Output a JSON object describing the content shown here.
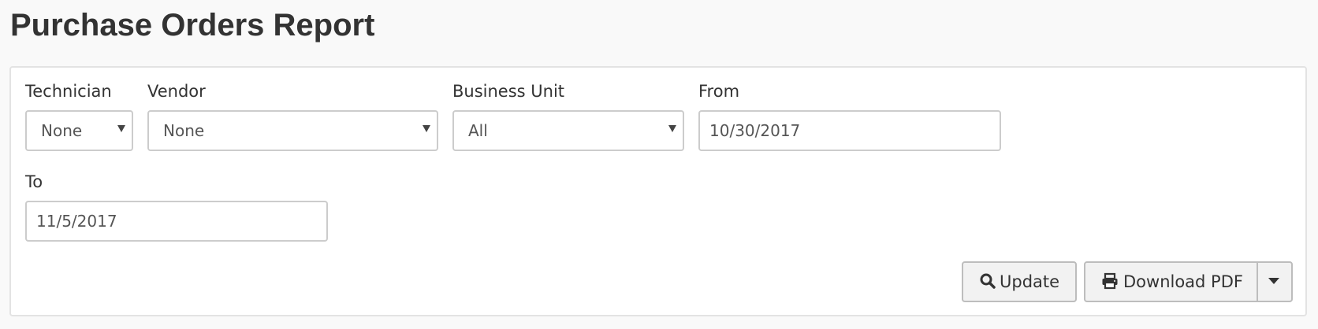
{
  "page": {
    "title": "Purchase Orders Report"
  },
  "filters": {
    "technician": {
      "label": "Technician",
      "value": "None"
    },
    "vendor": {
      "label": "Vendor",
      "value": "None"
    },
    "business_unit": {
      "label": "Business Unit",
      "value": "All"
    },
    "from": {
      "label": "From",
      "value": "10/30/2017"
    },
    "to": {
      "label": "To",
      "value": "11/5/2017"
    }
  },
  "actions": {
    "update_label": "Update",
    "update_icon": "search-icon",
    "download_label": "Download PDF",
    "download_icon": "printer-icon",
    "dropdown_icon": "caret-down-icon"
  },
  "colors": {
    "background": "#f9f9f9",
    "panel": "#ffffff",
    "border": "#cccccc",
    "button": "#f2f2f2",
    "text": "#333333"
  }
}
